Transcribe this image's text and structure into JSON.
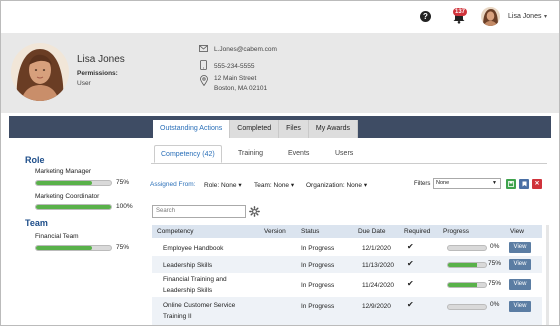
{
  "topbar": {
    "help_icon": "question-circle-icon",
    "notification_count": "137",
    "username": "Lisa Jones"
  },
  "profile": {
    "name": "Lisa Jones",
    "permissions_label": "Permissions:",
    "permissions_value": "User",
    "email": "L.Jones@cabem.com",
    "phone": "555-234-5555",
    "address_line1": "12 Main Street",
    "address_line2": "Boston, MA 02101"
  },
  "tabs": [
    "Outstanding Actions",
    "Completed",
    "Files",
    "My Awards"
  ],
  "subtabs": [
    "Competency (42)",
    "Training",
    "Events",
    "Users"
  ],
  "left": {
    "role_title": "Role",
    "roles": [
      {
        "label": "Marketing Manager",
        "progress": 75,
        "pct": "75%"
      },
      {
        "label": "Marketing Coordinator",
        "progress": 100,
        "pct": "100%"
      }
    ],
    "team_title": "Team",
    "teams": [
      {
        "label": "Financial Team",
        "progress": 75,
        "pct": "75%"
      }
    ]
  },
  "filters": {
    "assigned_from": "Assigned From:",
    "role": "Role: None",
    "team": "Team: None",
    "organization": "Organization: None",
    "filters_label": "Filters",
    "filters_value": "None",
    "colors": {
      "green": "#3fa34d",
      "blue": "#4a6fa5",
      "red": "#d0333b"
    }
  },
  "search": {
    "placeholder": "Search"
  },
  "table": {
    "headers": [
      "Competency",
      "Version",
      "Status",
      "Due Date",
      "Required",
      "Progress",
      "View"
    ],
    "rows": [
      {
        "competency": "Employee Handbook",
        "competency2": "",
        "status": "In Progress",
        "due": "12/1/2020",
        "progress": 0,
        "pct": "0%",
        "view": "View"
      },
      {
        "competency": "Leadership Skills",
        "competency2": "",
        "status": "In Progress",
        "due": "11/13/2020",
        "progress": 75,
        "pct": "75%",
        "view": "View"
      },
      {
        "competency": "Financial Training and",
        "competency2": "Leadership Skills",
        "status": "In Progress",
        "due": "11/24/2020",
        "progress": 75,
        "pct": "75%",
        "view": "View"
      },
      {
        "competency": "Online Customer Service",
        "competency2": "Training II",
        "status": "In Progress",
        "due": "12/9/2020",
        "progress": 0,
        "pct": "0%",
        "view": "View"
      }
    ]
  }
}
